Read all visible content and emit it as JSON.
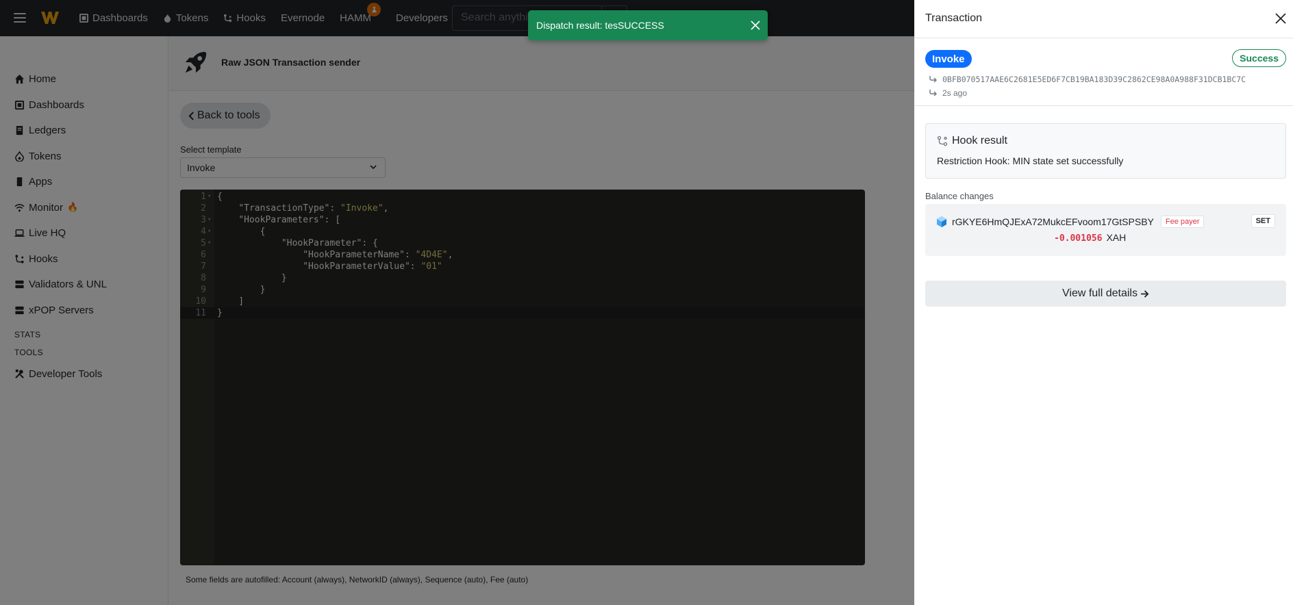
{
  "topnav": {
    "items": [
      {
        "label": "Dashboards",
        "icon": "dashboard-icon"
      },
      {
        "label": "Tokens",
        "icon": "flame-icon"
      },
      {
        "label": "Hooks",
        "icon": "hooks-icon"
      },
      {
        "label": "Evernode"
      },
      {
        "label": "HAMM",
        "icon": "flask-badge-icon"
      },
      {
        "label": "Developers",
        "icon": "caret-down-icon"
      }
    ],
    "search_placeholder": "Search anythi"
  },
  "sidebar": {
    "items": [
      {
        "label": "Home",
        "icon": "home-icon"
      },
      {
        "label": "Dashboards",
        "icon": "dashboard-icon"
      },
      {
        "label": "Ledgers",
        "icon": "ledger-icon"
      },
      {
        "label": "Tokens",
        "icon": "flame-icon"
      },
      {
        "label": "Apps",
        "icon": "phone-icon"
      },
      {
        "label": "Monitor",
        "icon": "wifi-icon",
        "emoji": "🔥"
      },
      {
        "label": "Live HQ",
        "icon": "laptop-icon"
      },
      {
        "label": "Hooks",
        "icon": "hooks-icon"
      },
      {
        "label": "Validators & UNL",
        "icon": "server-icon"
      },
      {
        "label": "xPOP Servers",
        "icon": "server-icon"
      }
    ],
    "headings": {
      "stats": "STATS",
      "tools": "TOOLS"
    },
    "tools_item": {
      "label": "Developer Tools",
      "icon": "tools-icon"
    }
  },
  "page": {
    "title": "Raw JSON Transaction sender",
    "back_label": "Back to tools",
    "select_label": "Select template",
    "select_value": "Invoke",
    "footnote": "Some fields are autofilled: Account (always), NetworkID (always), Sequence (auto), Fee (auto)"
  },
  "editor": {
    "active_line": 11,
    "lines": [
      "{",
      "    \"TransactionType\": \"Invoke\",",
      "    \"HookParameters\": [",
      "        {",
      "            \"HookParameter\": {",
      "                \"HookParameterName\": \"4D4E\",",
      "                \"HookParameterValue\": \"01\"",
      "            }",
      "        }",
      "    ]",
      "}"
    ],
    "fold_lines": [
      1,
      3,
      4,
      5
    ]
  },
  "toast": {
    "message": "Dispatch result: tesSUCCESS",
    "color": "#198754"
  },
  "drawer": {
    "title": "Transaction",
    "type_badge": "Invoke",
    "status_badge": "Success",
    "hash": "0BFB070517AAE6C2681E5ED6F7CB19BA183D39C2862CE98A0A988F31DCB1BC7C",
    "time_ago": "2s ago",
    "hook_result": {
      "title": "Hook result",
      "text": "Restriction Hook: MIN state set successfully"
    },
    "balance_changes_label": "Balance changes",
    "balance": {
      "account": "rGKYE6HmQJExA72MukcEFvoom17GtSPSBY",
      "fee_payer": "Fee payer",
      "set_badge": "SET",
      "amount": "-0.001056",
      "currency": "XAH"
    },
    "details_button": "View full details"
  },
  "colors": {
    "accent": "#0d6efd",
    "success": "#198754",
    "danger": "#dc3545",
    "topbar": "#212529"
  }
}
